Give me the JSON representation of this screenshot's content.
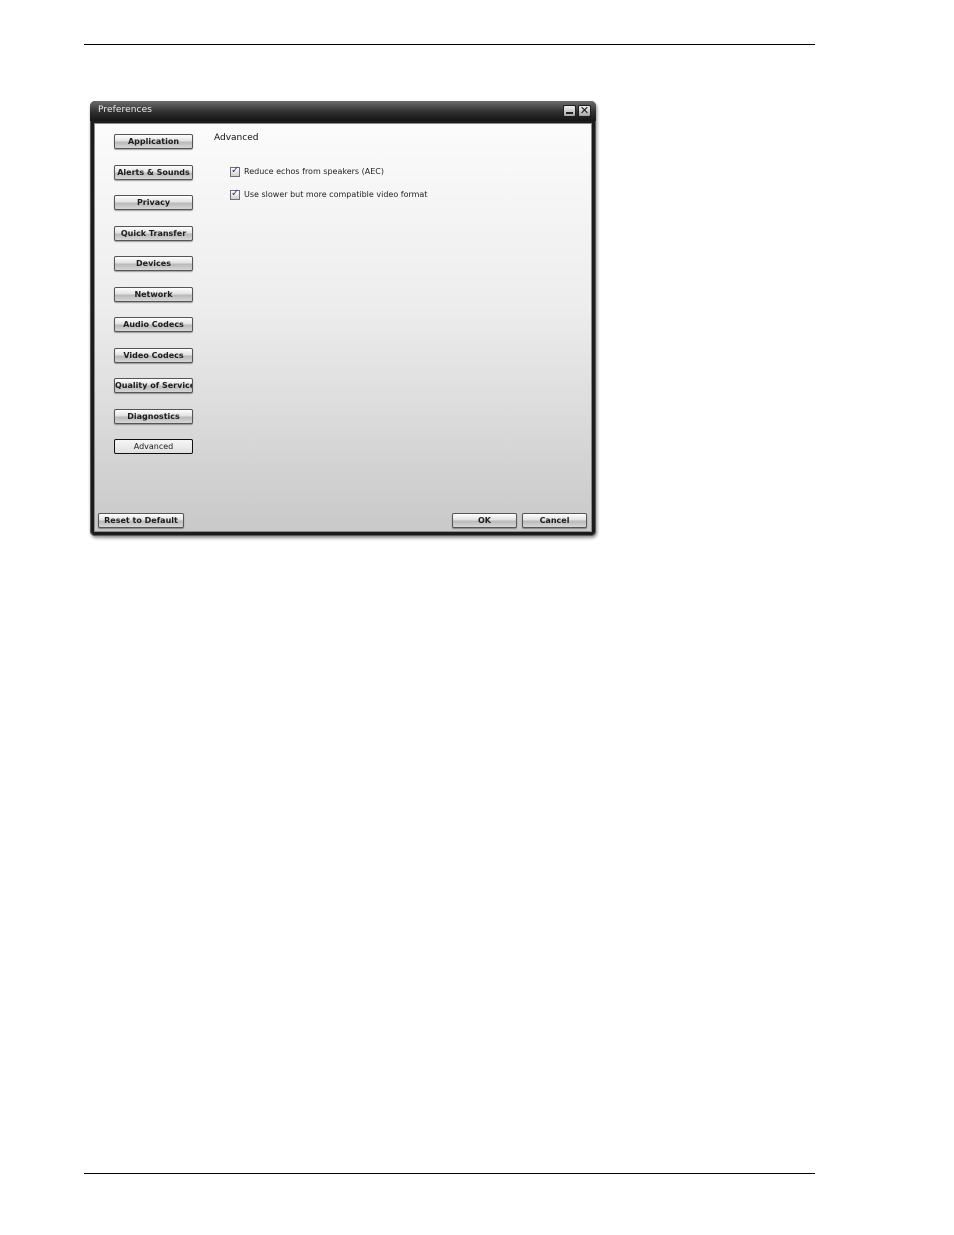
{
  "window": {
    "title": "Preferences",
    "close_glyph": "✕"
  },
  "sidebar": {
    "items": [
      {
        "label": "Application"
      },
      {
        "label": "Alerts & Sounds"
      },
      {
        "label": "Privacy"
      },
      {
        "label": "Quick Transfer"
      },
      {
        "label": "Devices"
      },
      {
        "label": "Network"
      },
      {
        "label": "Audio Codecs"
      },
      {
        "label": "Video Codecs"
      },
      {
        "label": "Quality of Service"
      },
      {
        "label": "Diagnostics"
      },
      {
        "label": "Advanced",
        "active": true
      }
    ]
  },
  "main": {
    "section_title": "Advanced",
    "checkboxes": [
      {
        "label": "Reduce echos from speakers (AEC)",
        "checked": true,
        "mark": "✓"
      },
      {
        "label": "Use slower but more compatible video format",
        "checked": true,
        "mark": "✓"
      }
    ]
  },
  "footer": {
    "reset_label": "Reset to Default",
    "ok_label": "OK",
    "cancel_label": "Cancel"
  },
  "icons": {
    "minimize": "minimize-icon",
    "close": "close-icon",
    "check": "checkmark-icon"
  }
}
